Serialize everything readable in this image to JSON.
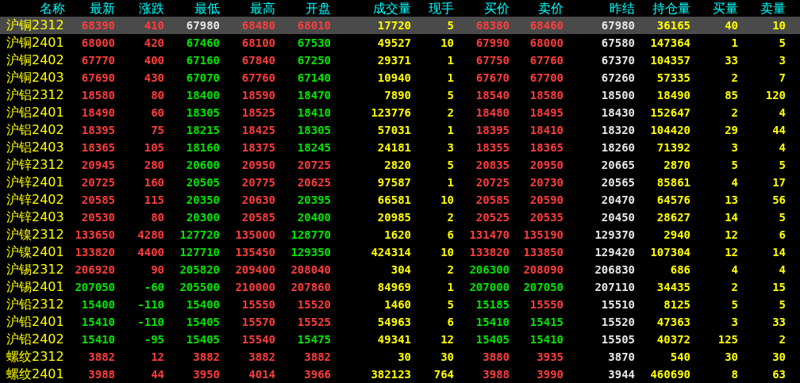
{
  "columns": [
    "名称",
    "最新",
    "涨跌",
    "最低",
    "最高",
    "开盘",
    "成交量",
    "现手",
    "买价",
    "卖价",
    "昨结",
    "持仓量",
    "买量",
    "卖量"
  ],
  "rows": [
    {
      "name": "沪铜2312",
      "selected": true,
      "cells": [
        {
          "text": "68390",
          "color": "#ff3c3c"
        },
        {
          "text": "410",
          "color": "#ff3c3c"
        },
        {
          "text": "67980",
          "color": "#e6e6e6"
        },
        {
          "text": "68480",
          "color": "#ff3c3c"
        },
        {
          "text": "68010",
          "color": "#ff3c3c"
        },
        {
          "text": "17720",
          "color": "#ffff00"
        },
        {
          "text": "5",
          "color": "#ffff00"
        },
        {
          "text": "68380",
          "color": "#ff3c3c"
        },
        {
          "text": "68460",
          "color": "#ff3c3c"
        },
        {
          "text": "67980",
          "color": "#e6e6e6"
        },
        {
          "text": "36165",
          "color": "#ffff00"
        },
        {
          "text": "40",
          "color": "#ffff00"
        },
        {
          "text": "10",
          "color": "#ffff00"
        }
      ]
    },
    {
      "name": "沪铜2401",
      "selected": false,
      "cells": [
        {
          "text": "68000",
          "color": "#ff3c3c"
        },
        {
          "text": "420",
          "color": "#ff3c3c"
        },
        {
          "text": "67460",
          "color": "#00e600"
        },
        {
          "text": "68100",
          "color": "#ff3c3c"
        },
        {
          "text": "67530",
          "color": "#00e600"
        },
        {
          "text": "49527",
          "color": "#ffff00"
        },
        {
          "text": "10",
          "color": "#ffff00"
        },
        {
          "text": "67990",
          "color": "#ff3c3c"
        },
        {
          "text": "68000",
          "color": "#ff3c3c"
        },
        {
          "text": "67580",
          "color": "#e6e6e6"
        },
        {
          "text": "147364",
          "color": "#ffff00"
        },
        {
          "text": "1",
          "color": "#ffff00"
        },
        {
          "text": "5",
          "color": "#ffff00"
        }
      ]
    },
    {
      "name": "沪铜2402",
      "selected": false,
      "cells": [
        {
          "text": "67770",
          "color": "#ff3c3c"
        },
        {
          "text": "400",
          "color": "#ff3c3c"
        },
        {
          "text": "67160",
          "color": "#00e600"
        },
        {
          "text": "67840",
          "color": "#ff3c3c"
        },
        {
          "text": "67250",
          "color": "#00e600"
        },
        {
          "text": "29371",
          "color": "#ffff00"
        },
        {
          "text": "1",
          "color": "#ffff00"
        },
        {
          "text": "67750",
          "color": "#ff3c3c"
        },
        {
          "text": "67760",
          "color": "#ff3c3c"
        },
        {
          "text": "67370",
          "color": "#e6e6e6"
        },
        {
          "text": "104357",
          "color": "#ffff00"
        },
        {
          "text": "33",
          "color": "#ffff00"
        },
        {
          "text": "3",
          "color": "#ffff00"
        }
      ]
    },
    {
      "name": "沪铜2403",
      "selected": false,
      "cells": [
        {
          "text": "67690",
          "color": "#ff3c3c"
        },
        {
          "text": "430",
          "color": "#ff3c3c"
        },
        {
          "text": "67070",
          "color": "#00e600"
        },
        {
          "text": "67760",
          "color": "#ff3c3c"
        },
        {
          "text": "67140",
          "color": "#00e600"
        },
        {
          "text": "10940",
          "color": "#ffff00"
        },
        {
          "text": "1",
          "color": "#ffff00"
        },
        {
          "text": "67670",
          "color": "#ff3c3c"
        },
        {
          "text": "67700",
          "color": "#ff3c3c"
        },
        {
          "text": "67260",
          "color": "#e6e6e6"
        },
        {
          "text": "57335",
          "color": "#ffff00"
        },
        {
          "text": "2",
          "color": "#ffff00"
        },
        {
          "text": "7",
          "color": "#ffff00"
        }
      ]
    },
    {
      "name": "沪铝2312",
      "selected": false,
      "cells": [
        {
          "text": "18580",
          "color": "#ff3c3c"
        },
        {
          "text": "80",
          "color": "#ff3c3c"
        },
        {
          "text": "18400",
          "color": "#00e600"
        },
        {
          "text": "18590",
          "color": "#ff3c3c"
        },
        {
          "text": "18470",
          "color": "#00e600"
        },
        {
          "text": "7890",
          "color": "#ffff00"
        },
        {
          "text": "5",
          "color": "#ffff00"
        },
        {
          "text": "18540",
          "color": "#ff3c3c"
        },
        {
          "text": "18580",
          "color": "#ff3c3c"
        },
        {
          "text": "18500",
          "color": "#e6e6e6"
        },
        {
          "text": "18490",
          "color": "#ffff00"
        },
        {
          "text": "85",
          "color": "#ffff00"
        },
        {
          "text": "120",
          "color": "#ffff00"
        }
      ]
    },
    {
      "name": "沪铝2401",
      "selected": false,
      "cells": [
        {
          "text": "18490",
          "color": "#ff3c3c"
        },
        {
          "text": "60",
          "color": "#ff3c3c"
        },
        {
          "text": "18305",
          "color": "#00e600"
        },
        {
          "text": "18525",
          "color": "#ff3c3c"
        },
        {
          "text": "18410",
          "color": "#00e600"
        },
        {
          "text": "123776",
          "color": "#ffff00"
        },
        {
          "text": "2",
          "color": "#ffff00"
        },
        {
          "text": "18480",
          "color": "#ff3c3c"
        },
        {
          "text": "18495",
          "color": "#ff3c3c"
        },
        {
          "text": "18430",
          "color": "#e6e6e6"
        },
        {
          "text": "152647",
          "color": "#ffff00"
        },
        {
          "text": "2",
          "color": "#ffff00"
        },
        {
          "text": "4",
          "color": "#ffff00"
        }
      ]
    },
    {
      "name": "沪铝2402",
      "selected": false,
      "cells": [
        {
          "text": "18395",
          "color": "#ff3c3c"
        },
        {
          "text": "75",
          "color": "#ff3c3c"
        },
        {
          "text": "18215",
          "color": "#00e600"
        },
        {
          "text": "18425",
          "color": "#ff3c3c"
        },
        {
          "text": "18305",
          "color": "#00e600"
        },
        {
          "text": "57031",
          "color": "#ffff00"
        },
        {
          "text": "1",
          "color": "#ffff00"
        },
        {
          "text": "18395",
          "color": "#ff3c3c"
        },
        {
          "text": "18410",
          "color": "#ff3c3c"
        },
        {
          "text": "18320",
          "color": "#e6e6e6"
        },
        {
          "text": "104420",
          "color": "#ffff00"
        },
        {
          "text": "29",
          "color": "#ffff00"
        },
        {
          "text": "44",
          "color": "#ffff00"
        }
      ]
    },
    {
      "name": "沪铝2403",
      "selected": false,
      "cells": [
        {
          "text": "18365",
          "color": "#ff3c3c"
        },
        {
          "text": "105",
          "color": "#ff3c3c"
        },
        {
          "text": "18160",
          "color": "#00e600"
        },
        {
          "text": "18375",
          "color": "#ff3c3c"
        },
        {
          "text": "18245",
          "color": "#00e600"
        },
        {
          "text": "24181",
          "color": "#ffff00"
        },
        {
          "text": "3",
          "color": "#ffff00"
        },
        {
          "text": "18355",
          "color": "#ff3c3c"
        },
        {
          "text": "18365",
          "color": "#ff3c3c"
        },
        {
          "text": "18260",
          "color": "#e6e6e6"
        },
        {
          "text": "71392",
          "color": "#ffff00"
        },
        {
          "text": "3",
          "color": "#ffff00"
        },
        {
          "text": "4",
          "color": "#ffff00"
        }
      ]
    },
    {
      "name": "沪锌2312",
      "selected": false,
      "cells": [
        {
          "text": "20945",
          "color": "#ff3c3c"
        },
        {
          "text": "280",
          "color": "#ff3c3c"
        },
        {
          "text": "20600",
          "color": "#00e600"
        },
        {
          "text": "20950",
          "color": "#ff3c3c"
        },
        {
          "text": "20725",
          "color": "#ff3c3c"
        },
        {
          "text": "2820",
          "color": "#ffff00"
        },
        {
          "text": "5",
          "color": "#ffff00"
        },
        {
          "text": "20835",
          "color": "#ff3c3c"
        },
        {
          "text": "20950",
          "color": "#ff3c3c"
        },
        {
          "text": "20665",
          "color": "#e6e6e6"
        },
        {
          "text": "2870",
          "color": "#ffff00"
        },
        {
          "text": "5",
          "color": "#ffff00"
        },
        {
          "text": "5",
          "color": "#ffff00"
        }
      ]
    },
    {
      "name": "沪锌2401",
      "selected": false,
      "cells": [
        {
          "text": "20725",
          "color": "#ff3c3c"
        },
        {
          "text": "160",
          "color": "#ff3c3c"
        },
        {
          "text": "20505",
          "color": "#00e600"
        },
        {
          "text": "20775",
          "color": "#ff3c3c"
        },
        {
          "text": "20625",
          "color": "#ff3c3c"
        },
        {
          "text": "97587",
          "color": "#ffff00"
        },
        {
          "text": "1",
          "color": "#ffff00"
        },
        {
          "text": "20725",
          "color": "#ff3c3c"
        },
        {
          "text": "20730",
          "color": "#ff3c3c"
        },
        {
          "text": "20565",
          "color": "#e6e6e6"
        },
        {
          "text": "85861",
          "color": "#ffff00"
        },
        {
          "text": "4",
          "color": "#ffff00"
        },
        {
          "text": "17",
          "color": "#ffff00"
        }
      ]
    },
    {
      "name": "沪锌2402",
      "selected": false,
      "cells": [
        {
          "text": "20585",
          "color": "#ff3c3c"
        },
        {
          "text": "115",
          "color": "#ff3c3c"
        },
        {
          "text": "20350",
          "color": "#00e600"
        },
        {
          "text": "20630",
          "color": "#ff3c3c"
        },
        {
          "text": "20395",
          "color": "#00e600"
        },
        {
          "text": "66581",
          "color": "#ffff00"
        },
        {
          "text": "10",
          "color": "#ffff00"
        },
        {
          "text": "20585",
          "color": "#ff3c3c"
        },
        {
          "text": "20590",
          "color": "#ff3c3c"
        },
        {
          "text": "20470",
          "color": "#e6e6e6"
        },
        {
          "text": "64576",
          "color": "#ffff00"
        },
        {
          "text": "13",
          "color": "#ffff00"
        },
        {
          "text": "56",
          "color": "#ffff00"
        }
      ]
    },
    {
      "name": "沪锌2403",
      "selected": false,
      "cells": [
        {
          "text": "20530",
          "color": "#ff3c3c"
        },
        {
          "text": "80",
          "color": "#ff3c3c"
        },
        {
          "text": "20300",
          "color": "#00e600"
        },
        {
          "text": "20585",
          "color": "#ff3c3c"
        },
        {
          "text": "20400",
          "color": "#00e600"
        },
        {
          "text": "20985",
          "color": "#ffff00"
        },
        {
          "text": "2",
          "color": "#ffff00"
        },
        {
          "text": "20525",
          "color": "#ff3c3c"
        },
        {
          "text": "20535",
          "color": "#ff3c3c"
        },
        {
          "text": "20450",
          "color": "#e6e6e6"
        },
        {
          "text": "28627",
          "color": "#ffff00"
        },
        {
          "text": "14",
          "color": "#ffff00"
        },
        {
          "text": "5",
          "color": "#ffff00"
        }
      ]
    },
    {
      "name": "沪镍2312",
      "selected": false,
      "cells": [
        {
          "text": "133650",
          "color": "#ff3c3c"
        },
        {
          "text": "4280",
          "color": "#ff3c3c"
        },
        {
          "text": "127720",
          "color": "#00e600"
        },
        {
          "text": "135000",
          "color": "#ff3c3c"
        },
        {
          "text": "128770",
          "color": "#00e600"
        },
        {
          "text": "1620",
          "color": "#ffff00"
        },
        {
          "text": "6",
          "color": "#ffff00"
        },
        {
          "text": "131470",
          "color": "#ff3c3c"
        },
        {
          "text": "135190",
          "color": "#ff3c3c"
        },
        {
          "text": "129370",
          "color": "#e6e6e6"
        },
        {
          "text": "2940",
          "color": "#ffff00"
        },
        {
          "text": "12",
          "color": "#ffff00"
        },
        {
          "text": "6",
          "color": "#ffff00"
        }
      ]
    },
    {
      "name": "沪镍2401",
      "selected": false,
      "cells": [
        {
          "text": "133820",
          "color": "#ff3c3c"
        },
        {
          "text": "4400",
          "color": "#ff3c3c"
        },
        {
          "text": "127710",
          "color": "#00e600"
        },
        {
          "text": "135450",
          "color": "#ff3c3c"
        },
        {
          "text": "129350",
          "color": "#00e600"
        },
        {
          "text": "424314",
          "color": "#ffff00"
        },
        {
          "text": "10",
          "color": "#ffff00"
        },
        {
          "text": "133820",
          "color": "#ff3c3c"
        },
        {
          "text": "133850",
          "color": "#ff3c3c"
        },
        {
          "text": "129420",
          "color": "#e6e6e6"
        },
        {
          "text": "107304",
          "color": "#ffff00"
        },
        {
          "text": "12",
          "color": "#ffff00"
        },
        {
          "text": "14",
          "color": "#ffff00"
        }
      ]
    },
    {
      "name": "沪锡2312",
      "selected": false,
      "cells": [
        {
          "text": "206920",
          "color": "#ff3c3c"
        },
        {
          "text": "90",
          "color": "#ff3c3c"
        },
        {
          "text": "205820",
          "color": "#00e600"
        },
        {
          "text": "209400",
          "color": "#ff3c3c"
        },
        {
          "text": "208040",
          "color": "#ff3c3c"
        },
        {
          "text": "304",
          "color": "#ffff00"
        },
        {
          "text": "2",
          "color": "#ffff00"
        },
        {
          "text": "206300",
          "color": "#00e600"
        },
        {
          "text": "208090",
          "color": "#ff3c3c"
        },
        {
          "text": "206830",
          "color": "#e6e6e6"
        },
        {
          "text": "686",
          "color": "#ffff00"
        },
        {
          "text": "4",
          "color": "#ffff00"
        },
        {
          "text": "4",
          "color": "#ffff00"
        }
      ]
    },
    {
      "name": "沪锡2401",
      "selected": false,
      "cells": [
        {
          "text": "207050",
          "color": "#00e600"
        },
        {
          "text": "-60",
          "color": "#00e600"
        },
        {
          "text": "205500",
          "color": "#00e600"
        },
        {
          "text": "210000",
          "color": "#ff3c3c"
        },
        {
          "text": "207860",
          "color": "#ff3c3c"
        },
        {
          "text": "84969",
          "color": "#ffff00"
        },
        {
          "text": "1",
          "color": "#ffff00"
        },
        {
          "text": "207000",
          "color": "#00e600"
        },
        {
          "text": "207050",
          "color": "#00e600"
        },
        {
          "text": "207110",
          "color": "#e6e6e6"
        },
        {
          "text": "34435",
          "color": "#ffff00"
        },
        {
          "text": "2",
          "color": "#ffff00"
        },
        {
          "text": "15",
          "color": "#ffff00"
        }
      ]
    },
    {
      "name": "沪铅2312",
      "selected": false,
      "cells": [
        {
          "text": "15400",
          "color": "#00e600"
        },
        {
          "text": "-110",
          "color": "#00e600"
        },
        {
          "text": "15400",
          "color": "#00e600"
        },
        {
          "text": "15550",
          "color": "#ff3c3c"
        },
        {
          "text": "15520",
          "color": "#ff3c3c"
        },
        {
          "text": "1460",
          "color": "#ffff00"
        },
        {
          "text": "5",
          "color": "#ffff00"
        },
        {
          "text": "15185",
          "color": "#00e600"
        },
        {
          "text": "15550",
          "color": "#ff3c3c"
        },
        {
          "text": "15510",
          "color": "#e6e6e6"
        },
        {
          "text": "8125",
          "color": "#ffff00"
        },
        {
          "text": "5",
          "color": "#ffff00"
        },
        {
          "text": "5",
          "color": "#ffff00"
        }
      ]
    },
    {
      "name": "沪铅2401",
      "selected": false,
      "cells": [
        {
          "text": "15410",
          "color": "#00e600"
        },
        {
          "text": "-110",
          "color": "#00e600"
        },
        {
          "text": "15405",
          "color": "#00e600"
        },
        {
          "text": "15570",
          "color": "#ff3c3c"
        },
        {
          "text": "15525",
          "color": "#ff3c3c"
        },
        {
          "text": "54963",
          "color": "#ffff00"
        },
        {
          "text": "6",
          "color": "#ffff00"
        },
        {
          "text": "15410",
          "color": "#00e600"
        },
        {
          "text": "15415",
          "color": "#00e600"
        },
        {
          "text": "15520",
          "color": "#e6e6e6"
        },
        {
          "text": "47363",
          "color": "#ffff00"
        },
        {
          "text": "3",
          "color": "#ffff00"
        },
        {
          "text": "33",
          "color": "#ffff00"
        }
      ]
    },
    {
      "name": "沪铅2402",
      "selected": false,
      "cells": [
        {
          "text": "15410",
          "color": "#00e600"
        },
        {
          "text": "-95",
          "color": "#00e600"
        },
        {
          "text": "15405",
          "color": "#00e600"
        },
        {
          "text": "15540",
          "color": "#ff3c3c"
        },
        {
          "text": "15475",
          "color": "#00e600"
        },
        {
          "text": "49341",
          "color": "#ffff00"
        },
        {
          "text": "12",
          "color": "#ffff00"
        },
        {
          "text": "15405",
          "color": "#00e600"
        },
        {
          "text": "15410",
          "color": "#00e600"
        },
        {
          "text": "15505",
          "color": "#e6e6e6"
        },
        {
          "text": "40372",
          "color": "#ffff00"
        },
        {
          "text": "125",
          "color": "#ffff00"
        },
        {
          "text": "2",
          "color": "#ffff00"
        }
      ]
    },
    {
      "name": "螺纹2312",
      "selected": false,
      "cells": [
        {
          "text": "3882",
          "color": "#ff3c3c"
        },
        {
          "text": "12",
          "color": "#ff3c3c"
        },
        {
          "text": "3882",
          "color": "#ff3c3c"
        },
        {
          "text": "3882",
          "color": "#ff3c3c"
        },
        {
          "text": "3882",
          "color": "#ff3c3c"
        },
        {
          "text": "30",
          "color": "#ffff00"
        },
        {
          "text": "30",
          "color": "#ffff00"
        },
        {
          "text": "3880",
          "color": "#ff3c3c"
        },
        {
          "text": "3935",
          "color": "#ff3c3c"
        },
        {
          "text": "3870",
          "color": "#e6e6e6"
        },
        {
          "text": "540",
          "color": "#ffff00"
        },
        {
          "text": "30",
          "color": "#ffff00"
        },
        {
          "text": "30",
          "color": "#ffff00"
        }
      ]
    },
    {
      "name": "螺纹2401",
      "selected": false,
      "cells": [
        {
          "text": "3988",
          "color": "#ff3c3c"
        },
        {
          "text": "44",
          "color": "#ff3c3c"
        },
        {
          "text": "3950",
          "color": "#ff3c3c"
        },
        {
          "text": "4014",
          "color": "#ff3c3c"
        },
        {
          "text": "3966",
          "color": "#ff3c3c"
        },
        {
          "text": "382123",
          "color": "#ffff00"
        },
        {
          "text": "764",
          "color": "#ffff00"
        },
        {
          "text": "3988",
          "color": "#ff3c3c"
        },
        {
          "text": "3990",
          "color": "#ff3c3c"
        },
        {
          "text": "3944",
          "color": "#e6e6e6"
        },
        {
          "text": "460690",
          "color": "#ffff00"
        },
        {
          "text": "8",
          "color": "#ffff00"
        },
        {
          "text": "63",
          "color": "#ffff00"
        }
      ]
    }
  ]
}
